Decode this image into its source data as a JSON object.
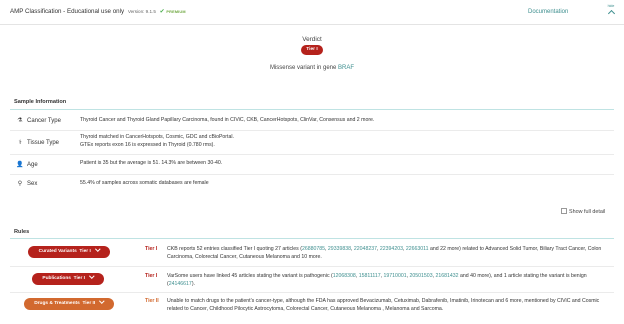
{
  "header": {
    "title": "AMP Classification - Educational use only",
    "version": "Version: 9.1.5",
    "premium": "PREMIUM",
    "documentation": "Documentation",
    "hide_label": "hide"
  },
  "verdict": {
    "title": "Verdict",
    "tier": "Tier I",
    "desc_prefix": "Missense variant in gene ",
    "gene": "BRAF"
  },
  "sample": {
    "title": "Sample Information",
    "rows": [
      {
        "icon": "microscope-icon",
        "label": "Cancer Type",
        "lines": [
          "Thyroid Cancer and Thyroid Gland Papillary Carcinoma, found in CIViC, CKB, CancerHotspots, ClinVar, Consensus and 2 more."
        ]
      },
      {
        "icon": "body-icon",
        "label": "Tissue Type",
        "lines": [
          "Thyroid matched in CancerHotspots, Cosmic, GDC and cBioPortal.",
          "GTEx reports exon 16 is expressed in Thyroid (0.780 rms)."
        ]
      },
      {
        "icon": "person-icon",
        "label": "Age",
        "lines": [
          "Patient is 35 but the average is 51. 14.3% are between 30-40."
        ]
      },
      {
        "icon": "sex-icon",
        "label": "Sex",
        "lines": [
          "55.4% of samples across somatic databases are female"
        ]
      }
    ]
  },
  "show_full_detail": "Show full detail",
  "rules": {
    "title": "Rules",
    "items": [
      {
        "name": "Curated Variants",
        "btn_tier": "Tier I",
        "tier": "Tier I",
        "color": "#b5221c",
        "text_a": "CKB reports 52 entries classified Tier I quoting 27 articles (",
        "refs": [
          "26880785",
          "29339838",
          "22048237",
          "22394203",
          "22663011"
        ],
        "text_b": " and 22 more) related to Advanced Solid Tumor, Biliary Tract Cancer, Colon Carcinoma, Colorectal Cancer, Cutaneous Melanoma and 10 more."
      },
      {
        "name": "Publications",
        "btn_tier": "Tier I",
        "tier": "Tier I",
        "color": "#b5221c",
        "text_a": "VarSome users have linked 45 articles stating the variant is pathogenic (",
        "refs": [
          "12068308",
          "15811117",
          "19710001",
          "20501503",
          "21681432"
        ],
        "text_b": " and 40 more), and 1 article stating the variant is benign (",
        "ref_benign": "24146617",
        "text_c": ")."
      },
      {
        "name": "Drugs & Treatments",
        "btn_tier": "Tier II",
        "tier": "Tier II",
        "color": "#d2692f",
        "text_a": "Unable to match drugs to the patient's cancer-type, although the FDA has approved Bevacizumab, Cetuximab, Dabrafenib, Imatinib, Irinotecan and 6 more, mentioned by CIViC and Cosmic related to Cancer, Childhood Pilocytic Astrocytoma, Colorectal Cancer, Cutaneous Melanoma , Melanoma and Sarcoma."
      }
    ]
  }
}
